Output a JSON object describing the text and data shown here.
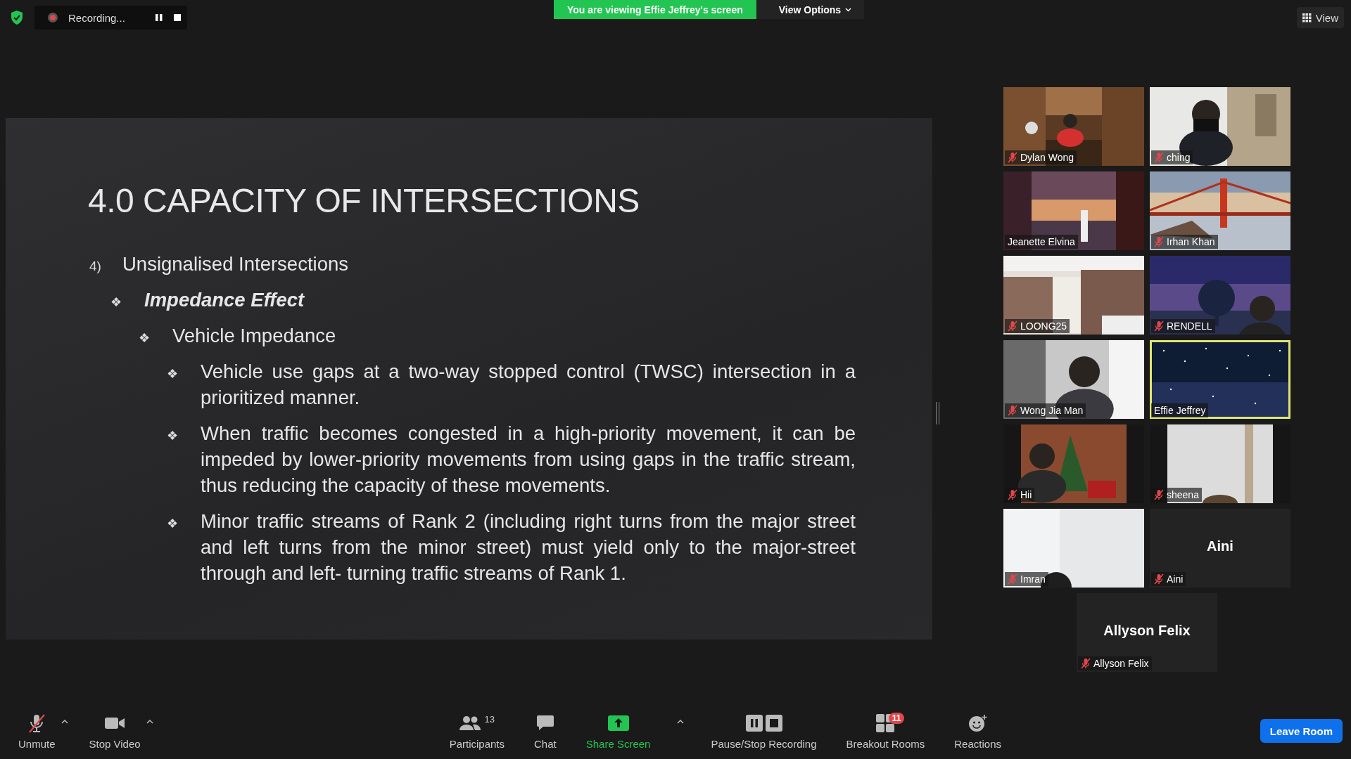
{
  "top_bar": {
    "recording": {
      "label": "Recording...",
      "paused": false
    },
    "banner": "You are viewing Effie Jeffrey's screen",
    "view_options": "View Options",
    "view": "View"
  },
  "slide": {
    "title": "4.0 CAPACITY OF INTERSECTIONS",
    "outline": [
      {
        "marker": "4)",
        "text": "Unsignalised Intersections",
        "emphasis": false,
        "children": [
          {
            "marker": "❖",
            "text": "Impedance Effect",
            "emphasis": true,
            "children": [
              {
                "marker": "❖",
                "text": "Vehicle Impedance",
                "emphasis": false,
                "children": [
                  {
                    "marker": "❖",
                    "text": "Vehicle use gaps at a two-way stopped control (TWSC) intersection in a prioritized manner.",
                    "emphasis": false
                  },
                  {
                    "marker": "❖",
                    "text": "When traffic becomes congested in a high-priority movement, it can be impeded by lower-priority movements from using gaps in the traffic stream, thus reducing the capacity of these movements.",
                    "emphasis": false
                  },
                  {
                    "marker": "❖",
                    "text": "Minor traffic streams of Rank 2 (including right turns from the major street and left turns from the minor street) must yield only to the major-street through and left- turning traffic streams of Rank 1.",
                    "emphasis": false
                  }
                ]
              }
            ]
          }
        ]
      }
    ]
  },
  "participants": [
    {
      "name": "Dylan Wong",
      "kind": "video",
      "muted": true,
      "speaking": false
    },
    {
      "name": "ching",
      "kind": "video",
      "muted": true,
      "speaking": false
    },
    {
      "name": "Jeanette Elvina",
      "kind": "video",
      "muted": false,
      "speaking": false
    },
    {
      "name": "Irhan Khan",
      "kind": "video",
      "muted": true,
      "speaking": false
    },
    {
      "name": "LOONG25",
      "kind": "video",
      "muted": true,
      "speaking": false
    },
    {
      "name": "RENDELL",
      "kind": "video",
      "muted": true,
      "speaking": false
    },
    {
      "name": "Wong Jia Man",
      "kind": "video",
      "muted": true,
      "speaking": false
    },
    {
      "name": "Effie Jeffrey",
      "kind": "video",
      "muted": false,
      "speaking": true
    },
    {
      "name": "Hii",
      "kind": "video",
      "muted": true,
      "speaking": false
    },
    {
      "name": "sheena",
      "kind": "video",
      "muted": true,
      "speaking": false
    },
    {
      "name": "Imran",
      "kind": "video",
      "muted": true,
      "speaking": false
    },
    {
      "name": "Aini",
      "kind": "name",
      "muted": true,
      "speaking": false,
      "display_name": "Aini"
    },
    {
      "name": "Allyson Felix",
      "kind": "name",
      "muted": true,
      "speaking": false,
      "display_name": "Allyson Felix"
    }
  ],
  "toolbar": {
    "items": [
      {
        "kind": "mic",
        "label": "Unmute",
        "muted": true,
        "caret": true
      },
      {
        "kind": "video",
        "label": "Stop Video",
        "caret": true
      },
      {
        "kind": "participants",
        "label": "Participants",
        "count": "13"
      },
      {
        "kind": "chat",
        "label": "Chat"
      },
      {
        "kind": "share",
        "label": "Share Screen",
        "caret": true
      },
      {
        "kind": "record",
        "label": "Pause/Stop Recording"
      },
      {
        "kind": "breakout",
        "label": "Breakout Rooms",
        "badge": "11"
      },
      {
        "kind": "reactions",
        "label": "Reactions"
      }
    ],
    "leave": "Leave Room"
  }
}
